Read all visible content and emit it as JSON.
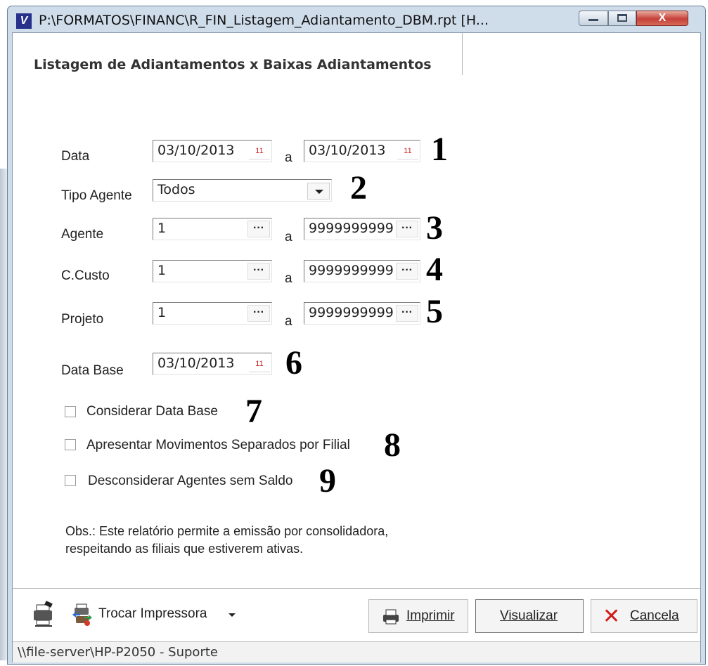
{
  "window": {
    "title": "P:\\FORMATOS\\FINANC\\R_FIN_Listagem_Adiantamento_DBM.rpt [H...",
    "close_glyph": "X"
  },
  "tab": {
    "label": "Listagem de Adiantamentos x Baixas Adiantamentos"
  },
  "form": {
    "data": {
      "label": "Data",
      "from": "03/10/2013",
      "separator": "a",
      "to": "03/10/2013",
      "marker": "1"
    },
    "tipo_agente": {
      "label": "Tipo Agente",
      "value": "Todos",
      "marker": "2"
    },
    "agente": {
      "label": "Agente",
      "from": "1",
      "separator": "a",
      "to": "9999999999",
      "marker": "3"
    },
    "ccusto": {
      "label": "C.Custo",
      "from": "1",
      "separator": "a",
      "to": "9999999999",
      "marker": "4"
    },
    "projeto": {
      "label": "Projeto",
      "from": "1",
      "separator": "a",
      "to": "9999999999",
      "marker": "5"
    },
    "data_base": {
      "label": "Data Base",
      "value": "03/10/2013",
      "marker": "6"
    },
    "chk_considerar": {
      "label": "Considerar Data Base",
      "checked": false,
      "marker": "7"
    },
    "chk_apresentar": {
      "label": "Apresentar Movimentos Separados por Filial",
      "checked": false,
      "marker": "8"
    },
    "chk_desconsiderar": {
      "label": "Desconsiderar Agentes sem Saldo",
      "checked": false,
      "marker": "9"
    },
    "obs_line1": "Obs.: Este relatório permite a emissão por consolidadora,",
    "obs_line2": "respeitando as filiais que estiverem ativas."
  },
  "buttons": {
    "trocar": "Trocar Impressora",
    "imprimir": "Imprimir",
    "visualizar": "Visualizar",
    "cancela": "Cancela"
  },
  "statusbar": {
    "text": "\\\\file-server\\HP-P2050 - Suporte"
  },
  "icons": {
    "calendar_glyph": "11",
    "ellipsis_glyph": "···",
    "cancel_glyph": "✕"
  },
  "colors": {
    "cancel_x": "#d11a1a",
    "calendar_red": "#c22222",
    "close_button": "#c5413a"
  }
}
